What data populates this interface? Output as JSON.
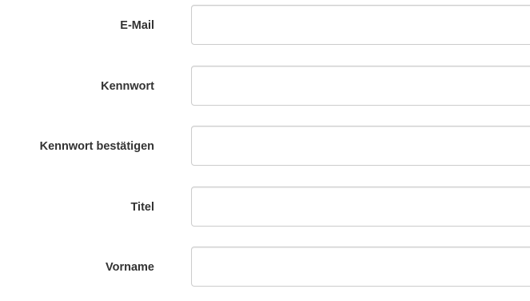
{
  "form": {
    "fields": [
      {
        "label": "E-Mail",
        "value": "",
        "placeholder": ""
      },
      {
        "label": "Kennwort",
        "value": "",
        "placeholder": ""
      },
      {
        "label": "Kennwort bestätigen",
        "value": "",
        "placeholder": ""
      },
      {
        "label": "Titel",
        "value": "",
        "placeholder": ""
      },
      {
        "label": "Vorname",
        "value": "",
        "placeholder": ""
      }
    ]
  }
}
